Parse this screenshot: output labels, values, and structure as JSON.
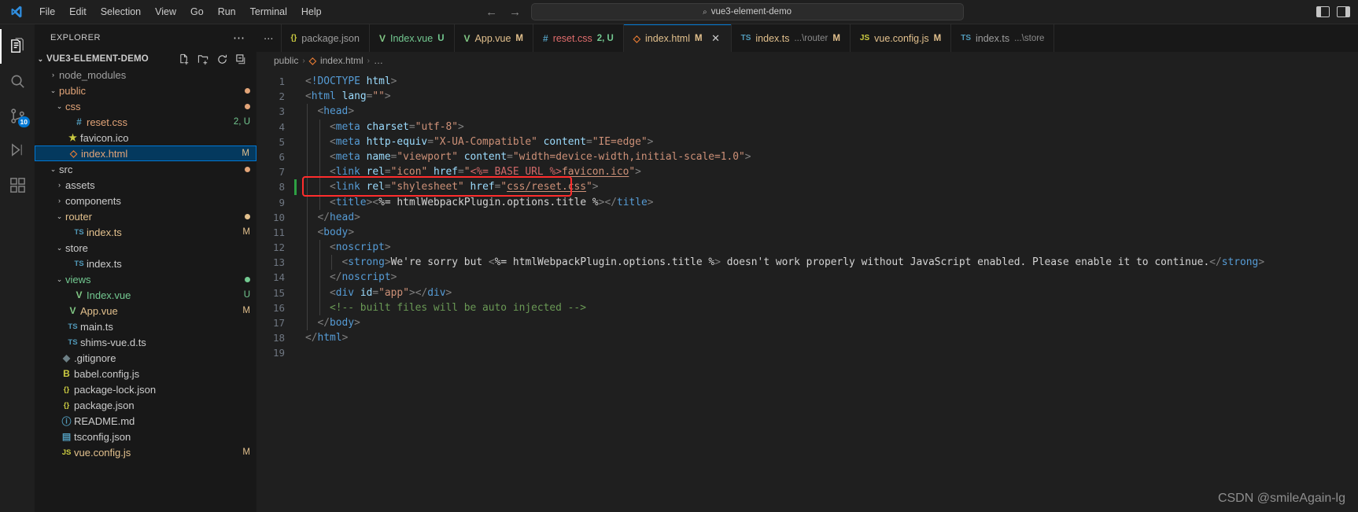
{
  "titlebar": {
    "logo_name": "vscode-logo",
    "menus": [
      "File",
      "Edit",
      "Selection",
      "View",
      "Go",
      "Run",
      "Terminal",
      "Help"
    ],
    "back_arrow": "←",
    "forward_arrow": "→",
    "search": {
      "icon": "⌕",
      "value": "vue3-element-demo"
    },
    "right_icons": [
      "panel-layout-left-icon",
      "panel-layout-right-icon"
    ]
  },
  "activitybar": {
    "items": [
      {
        "name": "explorer",
        "icon": "files-icon",
        "active": true,
        "badge": ""
      },
      {
        "name": "search",
        "icon": "search-icon",
        "active": false,
        "badge": ""
      },
      {
        "name": "source-control",
        "icon": "source-control-icon",
        "active": false,
        "badge": "10"
      },
      {
        "name": "run-and-debug",
        "icon": "debug-icon",
        "active": false,
        "badge": ""
      },
      {
        "name": "extensions",
        "icon": "extensions-icon",
        "active": false,
        "badge": ""
      }
    ]
  },
  "sidebar": {
    "title": "EXPLORER",
    "more_actions": "⋯",
    "root": {
      "label": "VUE3-ELEMENT-DEMO",
      "chevron": "⌄",
      "actions": [
        "new-file-icon",
        "new-folder-icon",
        "refresh-icon",
        "collapse-all-icon"
      ]
    },
    "items": [
      {
        "label": "node_modules",
        "indent": 1,
        "chevron": "›",
        "icon": "",
        "icon_color": "#cccccc",
        "color": "#a0a0a0",
        "badge": "",
        "badge_color": "",
        "dot": "",
        "selected": false
      },
      {
        "label": "public",
        "indent": 1,
        "chevron": "⌄",
        "icon": "",
        "icon_color": "#cccccc",
        "color": "#e2a478",
        "badge": "",
        "badge_color": "",
        "dot": "#e2a478",
        "selected": false
      },
      {
        "label": "css",
        "indent": 2,
        "chevron": "⌄",
        "icon": "",
        "icon_color": "#cccccc",
        "color": "#e2a478",
        "badge": "",
        "badge_color": "",
        "dot": "#e2a478",
        "selected": false
      },
      {
        "label": "reset.css",
        "indent": 3,
        "chevron": "",
        "icon": "#",
        "icon_color": "#519aba",
        "color": "#e2a478",
        "badge": "2, U",
        "badge_color": "#73c991",
        "dot": "",
        "selected": false
      },
      {
        "label": "favicon.ico",
        "indent": 2,
        "chevron": "",
        "icon": "★",
        "icon_color": "#cbcb41",
        "color": "#cccccc",
        "badge": "",
        "badge_color": "",
        "dot": "",
        "selected": false
      },
      {
        "label": "index.html",
        "indent": 2,
        "chevron": "",
        "icon": "◇",
        "icon_color": "#e37933",
        "color": "#e2a478",
        "badge": "M",
        "badge_color": "#e2c08d",
        "dot": "",
        "selected": true
      },
      {
        "label": "src",
        "indent": 1,
        "chevron": "⌄",
        "icon": "",
        "icon_color": "#cccccc",
        "color": "#cccccc",
        "badge": "",
        "badge_color": "",
        "dot": "#e2a478",
        "selected": false
      },
      {
        "label": "assets",
        "indent": 2,
        "chevron": "›",
        "icon": "",
        "icon_color": "#cccccc",
        "color": "#cccccc",
        "badge": "",
        "badge_color": "",
        "dot": "",
        "selected": false
      },
      {
        "label": "components",
        "indent": 2,
        "chevron": "›",
        "icon": "",
        "icon_color": "#cccccc",
        "color": "#cccccc",
        "badge": "",
        "badge_color": "",
        "dot": "",
        "selected": false
      },
      {
        "label": "router",
        "indent": 2,
        "chevron": "⌄",
        "icon": "",
        "icon_color": "#cccccc",
        "color": "#e2c08d",
        "badge": "",
        "badge_color": "",
        "dot": "#e2c08d",
        "selected": false
      },
      {
        "label": "index.ts",
        "indent": 3,
        "chevron": "",
        "icon": "TS",
        "icon_color": "#519aba",
        "color": "#e2c08d",
        "badge": "M",
        "badge_color": "#e2c08d",
        "dot": "",
        "selected": false
      },
      {
        "label": "store",
        "indent": 2,
        "chevron": "⌄",
        "icon": "",
        "icon_color": "#cccccc",
        "color": "#cccccc",
        "badge": "",
        "badge_color": "",
        "dot": "",
        "selected": false
      },
      {
        "label": "index.ts",
        "indent": 3,
        "chevron": "",
        "icon": "TS",
        "icon_color": "#519aba",
        "color": "#cccccc",
        "badge": "",
        "badge_color": "",
        "dot": "",
        "selected": false
      },
      {
        "label": "views",
        "indent": 2,
        "chevron": "⌄",
        "icon": "",
        "icon_color": "#cccccc",
        "color": "#73c991",
        "badge": "",
        "badge_color": "",
        "dot": "#73c991",
        "selected": false
      },
      {
        "label": "Index.vue",
        "indent": 3,
        "chevron": "",
        "icon": "V",
        "icon_color": "#81c784",
        "color": "#73c991",
        "badge": "U",
        "badge_color": "#73c991",
        "dot": "",
        "selected": false
      },
      {
        "label": "App.vue",
        "indent": 2,
        "chevron": "",
        "icon": "V",
        "icon_color": "#81c784",
        "color": "#e2c08d",
        "badge": "M",
        "badge_color": "#e2c08d",
        "dot": "",
        "selected": false
      },
      {
        "label": "main.ts",
        "indent": 2,
        "chevron": "",
        "icon": "TS",
        "icon_color": "#519aba",
        "color": "#cccccc",
        "badge": "",
        "badge_color": "",
        "dot": "",
        "selected": false
      },
      {
        "label": "shims-vue.d.ts",
        "indent": 2,
        "chevron": "",
        "icon": "TS",
        "icon_color": "#519aba",
        "color": "#cccccc",
        "badge": "",
        "badge_color": "",
        "dot": "",
        "selected": false
      },
      {
        "label": ".gitignore",
        "indent": 1,
        "chevron": "",
        "icon": "◆",
        "icon_color": "#6d8086",
        "color": "#cccccc",
        "badge": "",
        "badge_color": "",
        "dot": "",
        "selected": false
      },
      {
        "label": "babel.config.js",
        "indent": 1,
        "chevron": "",
        "icon": "B",
        "icon_color": "#cbcb41",
        "color": "#cccccc",
        "badge": "",
        "badge_color": "",
        "dot": "",
        "selected": false
      },
      {
        "label": "package-lock.json",
        "indent": 1,
        "chevron": "",
        "icon": "{}",
        "icon_color": "#cbcb41",
        "color": "#cccccc",
        "badge": "",
        "badge_color": "",
        "dot": "",
        "selected": false
      },
      {
        "label": "package.json",
        "indent": 1,
        "chevron": "",
        "icon": "{}",
        "icon_color": "#cbcb41",
        "color": "#cccccc",
        "badge": "",
        "badge_color": "",
        "dot": "",
        "selected": false
      },
      {
        "label": "README.md",
        "indent": 1,
        "chevron": "",
        "icon": "ⓘ",
        "icon_color": "#519aba",
        "color": "#cccccc",
        "badge": "",
        "badge_color": "",
        "dot": "",
        "selected": false
      },
      {
        "label": "tsconfig.json",
        "indent": 1,
        "chevron": "",
        "icon": "▤",
        "icon_color": "#519aba",
        "color": "#cccccc",
        "badge": "",
        "badge_color": "",
        "dot": "",
        "selected": false
      },
      {
        "label": "vue.config.js",
        "indent": 1,
        "chevron": "",
        "icon": "JS",
        "icon_color": "#cbcb41",
        "color": "#e2c08d",
        "badge": "M",
        "badge_color": "#e2c08d",
        "dot": "",
        "selected": false
      }
    ]
  },
  "editor": {
    "overflow_indicator": "⋯",
    "tabs": [
      {
        "icon": "{}",
        "icon_color": "#cbcb41",
        "label": "package.json",
        "dim": "",
        "status": "",
        "status_color": "",
        "label_color": "#9d9d9d",
        "active": false,
        "close": ""
      },
      {
        "icon": "V",
        "icon_color": "#81c784",
        "label": "Index.vue",
        "dim": "",
        "status": "U",
        "status_color": "#73c991",
        "label_color": "#73c991",
        "active": false,
        "close": ""
      },
      {
        "icon": "V",
        "icon_color": "#81c784",
        "label": "App.vue",
        "dim": "",
        "status": "M",
        "status_color": "#e2c08d",
        "label_color": "#e2c08d",
        "active": false,
        "close": ""
      },
      {
        "icon": "#",
        "icon_color": "#519aba",
        "label": "reset.css",
        "dim": "",
        "status": "2, U",
        "status_color": "#73c991",
        "label_color": "#e06c6c",
        "active": false,
        "close": ""
      },
      {
        "icon": "◇",
        "icon_color": "#e37933",
        "label": "index.html",
        "dim": "",
        "status": "M",
        "status_color": "#e2c08d",
        "label_color": "#e2c08d",
        "active": true,
        "close": "✕"
      },
      {
        "icon": "TS",
        "icon_color": "#519aba",
        "label": "index.ts",
        "dim": "...\\router",
        "status": "M",
        "status_color": "#e2c08d",
        "label_color": "#e2c08d",
        "active": false,
        "close": ""
      },
      {
        "icon": "JS",
        "icon_color": "#cbcb41",
        "label": "vue.config.js",
        "dim": "",
        "status": "M",
        "status_color": "#e2c08d",
        "label_color": "#e2c08d",
        "active": false,
        "close": ""
      },
      {
        "icon": "TS",
        "icon_color": "#519aba",
        "label": "index.ts",
        "dim": "...\\store",
        "status": "",
        "status_color": "",
        "label_color": "#9d9d9d",
        "active": false,
        "close": ""
      }
    ],
    "breadcrumb": {
      "folder": "public",
      "sep": "›",
      "file_icon": "◇",
      "file": "index.html",
      "tail": "…"
    },
    "line_numbers": [
      "1",
      "2",
      "3",
      "4",
      "5",
      "6",
      "7",
      "8",
      "9",
      "10",
      "11",
      "12",
      "13",
      "14",
      "15",
      "16",
      "17",
      "18",
      "19"
    ],
    "modified_lines": [
      8
    ],
    "annotation": {
      "color": "#ff2d2d",
      "target_line": 8
    },
    "code_lines": [
      {
        "n": 1,
        "indent": 0,
        "text": "<!DOCTYPE html>"
      },
      {
        "n": 2,
        "indent": 0,
        "text": "<html lang=\"\">"
      },
      {
        "n": 3,
        "indent": 1,
        "text": "<head>"
      },
      {
        "n": 4,
        "indent": 2,
        "text": "<meta charset=\"utf-8\">"
      },
      {
        "n": 5,
        "indent": 2,
        "text": "<meta http-equiv=\"X-UA-Compatible\" content=\"IE=edge\">"
      },
      {
        "n": 6,
        "indent": 2,
        "text": "<meta name=\"viewport\" content=\"width=device-width,initial-scale=1.0\">"
      },
      {
        "n": 7,
        "indent": 2,
        "text": "<link rel=\"icon\" href=\"<%= BASE_URL %>favicon.ico\">"
      },
      {
        "n": 8,
        "indent": 2,
        "text": "<link rel=\"shylesheet\" href=\"css/reset.css\">"
      },
      {
        "n": 9,
        "indent": 2,
        "text": "<title><%= htmlWebpackPlugin.options.title %></title>"
      },
      {
        "n": 10,
        "indent": 1,
        "text": "</head>"
      },
      {
        "n": 11,
        "indent": 1,
        "text": "<body>"
      },
      {
        "n": 12,
        "indent": 2,
        "text": "<noscript>"
      },
      {
        "n": 13,
        "indent": 3,
        "text": "<strong>We're sorry but <%= htmlWebpackPlugin.options.title %> doesn't work properly without JavaScript enabled. Please enable it to continue.</strong>"
      },
      {
        "n": 14,
        "indent": 2,
        "text": "</noscript>"
      },
      {
        "n": 15,
        "indent": 2,
        "text": "<div id=\"app\"></div>"
      },
      {
        "n": 16,
        "indent": 2,
        "text": "<!-- built files will be auto injected -->"
      },
      {
        "n": 17,
        "indent": 1,
        "text": "</body>"
      },
      {
        "n": 18,
        "indent": 0,
        "text": "</html>"
      },
      {
        "n": 19,
        "indent": 0,
        "text": ""
      }
    ]
  },
  "watermark": "CSDN @smileAgain-lg",
  "colors": {
    "accent": "#0078d4",
    "selection_bg": "#04395e",
    "editor_bg": "#1f1f1f",
    "sidebar_bg": "#181818",
    "annotation_red": "#ff2d2d",
    "modified_green": "#2ea043"
  }
}
